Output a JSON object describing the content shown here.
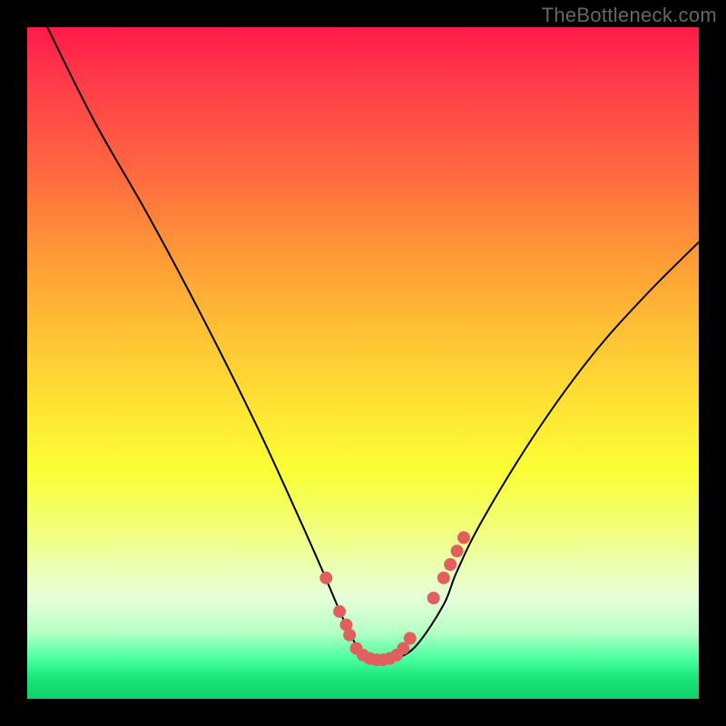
{
  "watermark": "TheBottleneck.com",
  "chart_data": {
    "type": "line",
    "title": "",
    "xlabel": "",
    "ylabel": "",
    "xlim": [
      0,
      100
    ],
    "ylim": [
      0,
      100
    ],
    "grid": false,
    "series": [
      {
        "name": "curve",
        "x": [
          3,
          10,
          18,
          26,
          34,
          40,
          44,
          47,
          49,
          51,
          53,
          55,
          58,
          62,
          64,
          68,
          76,
          84,
          92,
          100
        ],
        "y": [
          100,
          86,
          72,
          57,
          41,
          28,
          19,
          12,
          8,
          6,
          5.5,
          6,
          8,
          14,
          19,
          27,
          40,
          51,
          60,
          68
        ]
      }
    ],
    "highlight_points": {
      "name": "dots",
      "color": "#e06060",
      "x": [
        44.5,
        46.5,
        47.5,
        48,
        49,
        50,
        51,
        52,
        53,
        54,
        55,
        56,
        57,
        60.5,
        62,
        63,
        64,
        65
      ],
      "y": [
        18,
        13,
        11,
        9.5,
        7.5,
        6.5,
        6,
        5.8,
        5.8,
        6,
        6.5,
        7.5,
        9,
        15,
        18,
        20,
        22,
        24
      ]
    },
    "background": {
      "type": "vertical-gradient",
      "stops": [
        {
          "pos": 0,
          "color": "#ff1a4a"
        },
        {
          "pos": 50,
          "color": "#ffe534"
        },
        {
          "pos": 100,
          "color": "#11d06b"
        }
      ]
    }
  }
}
